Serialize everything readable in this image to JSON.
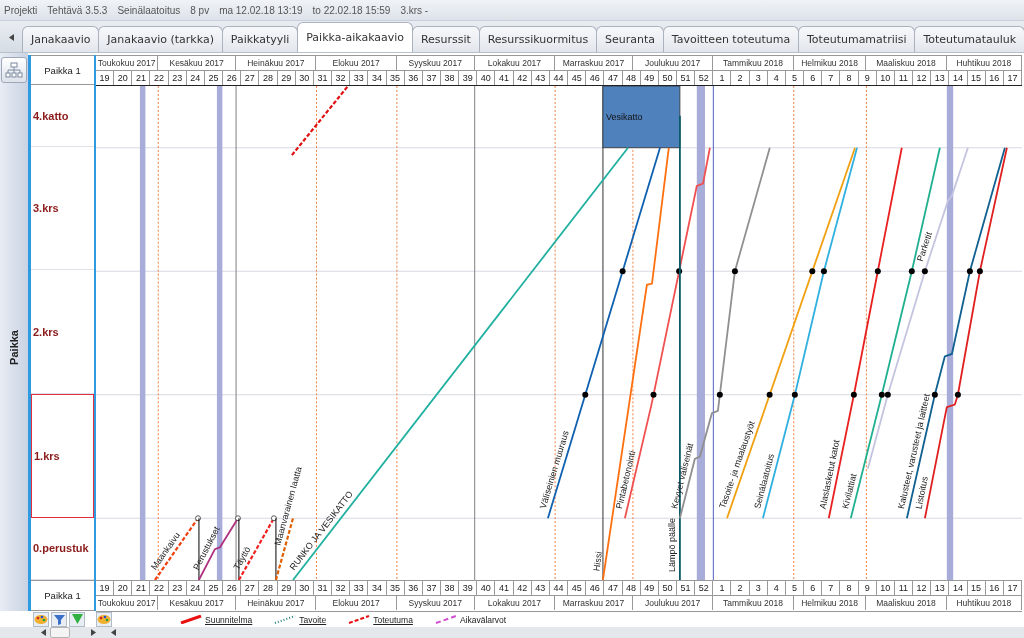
{
  "status_bar": {
    "items": [
      "Projekti",
      "Tehtävä 3.5.3",
      "Seinälaatoitus",
      "8 pv",
      "ma 12.02.18 13:19",
      "to 22.02.18 15:59",
      "3.krs -"
    ]
  },
  "tabs": [
    {
      "label": "Janakaavio",
      "selected": false
    },
    {
      "label": "Janakaavio (tarkka)",
      "selected": false
    },
    {
      "label": "Paikkatyyli",
      "selected": false
    },
    {
      "label": "Paikka-aikakaavio",
      "selected": true
    },
    {
      "label": "Resurssit",
      "selected": false
    },
    {
      "label": "Resurssikuormitus",
      "selected": false
    },
    {
      "label": "Seuranta",
      "selected": false
    },
    {
      "label": "Tavoitteen toteutuma",
      "selected": false
    },
    {
      "label": "Toteutumamatriisi",
      "selected": false
    },
    {
      "label": "Toteutumatauluk",
      "selected": false
    }
  ],
  "side_panel": {
    "title": "Paikka"
  },
  "locations": [
    {
      "name": "4.katto",
      "selected": false
    },
    {
      "name": "3.krs",
      "selected": false
    },
    {
      "name": "2.krs",
      "selected": false
    },
    {
      "name": "1.krs",
      "selected": true
    },
    {
      "name": "0.perustuk",
      "selected": false
    }
  ],
  "chart": {
    "axis_top": {
      "label": "Paikka 1",
      "months": [
        "Toukokuu 2017",
        "Kesäkuu 2017",
        "Heinäkuu 2017",
        "Elokuu 2017",
        "Syyskuu 2017",
        "Lokakuu 2017",
        "Marraskuu 2017",
        "Joulukuu 2017",
        "Tammikuu 2018",
        "Helmikuu 2018",
        "Maaliskuu 2018",
        "Huhtikuu 2018"
      ],
      "weeks": [
        "19",
        "20",
        "21",
        "22",
        "23",
        "24",
        "25",
        "26",
        "27",
        "28",
        "29",
        "30",
        "31",
        "32",
        "33",
        "34",
        "35",
        "36",
        "37",
        "38",
        "39",
        "40",
        "41",
        "42",
        "43",
        "44",
        "45",
        "46",
        "47",
        "48",
        "49",
        "50",
        "51",
        "52",
        "1",
        "2",
        "3",
        "4",
        "5",
        "6",
        "7",
        "8",
        "9",
        "10",
        "11",
        "12",
        "13",
        "14",
        "15",
        "16",
        "17"
      ]
    },
    "tasks": [
      {
        "name": "Maankaivu",
        "kind": "line"
      },
      {
        "name": "Perustukset",
        "kind": "line"
      },
      {
        "name": "Täyttö",
        "kind": "line"
      },
      {
        "name": "Maanvarainen laatta",
        "kind": "line"
      },
      {
        "name": "RUNKO JA VESIKATTO",
        "kind": "line"
      },
      {
        "name": "Väliseinien muuraus",
        "kind": "line"
      },
      {
        "name": "Hissi",
        "kind": "line"
      },
      {
        "name": "Pintabetonointi",
        "kind": "line"
      },
      {
        "name": "Lämpö päälle",
        "kind": "line"
      },
      {
        "name": "Kevyet väliseinät",
        "kind": "line"
      },
      {
        "name": "Tasoite- ja maalaustyöt",
        "kind": "line"
      },
      {
        "name": "Seinälaatoitus",
        "kind": "line"
      },
      {
        "name": "Alaslasketut katot",
        "kind": "line"
      },
      {
        "name": "Kivilattiat",
        "kind": "line"
      },
      {
        "name": "Parketit",
        "kind": "line"
      },
      {
        "name": "Kalusteet, varusteet ja laitteet",
        "kind": "line"
      },
      {
        "name": "Listoitus",
        "kind": "line"
      },
      {
        "name": "Vesikatto",
        "kind": "block"
      }
    ],
    "axis_bottom": {
      "label": "Paikka 1",
      "weeks": [
        "19",
        "20",
        "21",
        "22",
        "23",
        "24",
        "25",
        "26",
        "27",
        "28",
        "29",
        "30",
        "31",
        "32",
        "33",
        "34",
        "35",
        "36",
        "37",
        "38",
        "39",
        "40",
        "41",
        "42",
        "43",
        "44",
        "45",
        "46",
        "47",
        "48",
        "49",
        "50",
        "51",
        "52",
        "1",
        "2",
        "3",
        "4",
        "5",
        "6",
        "7",
        "8",
        "9",
        "10",
        "11",
        "12",
        "13",
        "14",
        "15",
        "16",
        "17"
      ],
      "months": [
        "Toukokuu 2017",
        "Kesäkuu 2017",
        "Heinäkuu 2017",
        "Elokuu 2017",
        "Syyskuu 2017",
        "Lokakuu 2017",
        "Marraskuu 2017",
        "Joulukuu 2017",
        "Tammikuu 2018",
        "Helmikuu 2018",
        "Maaliskuu 2018",
        "Huhtikuu 2018"
      ]
    }
  },
  "legend": [
    {
      "label": "Suunnitelma",
      "kind": "plan"
    },
    {
      "label": "Tavoite",
      "kind": "target"
    },
    {
      "label": "Toteutuma",
      "kind": "actual"
    },
    {
      "label": "Aikavälarvot",
      "kind": "interval"
    }
  ]
}
